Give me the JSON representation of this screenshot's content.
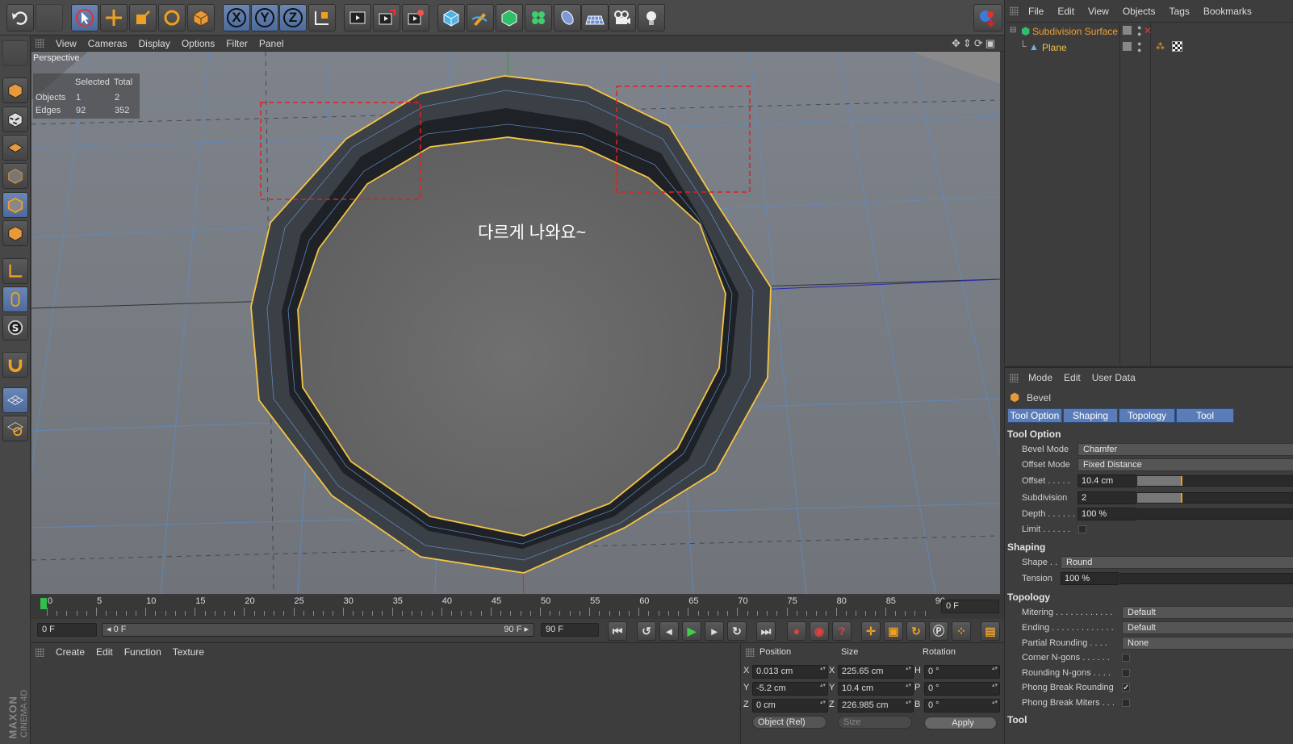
{
  "toolbar": {
    "axis_x": "X",
    "axis_y": "Y",
    "axis_z": "Z",
    "icons": [
      "undo-icon",
      "redo-icon",
      "select-icon",
      "move-icon",
      "scale-icon",
      "rotate-icon",
      "live-selection-icon",
      "world-coords-icon",
      "render-view-icon",
      "render-picture-viewer-icon",
      "render-settings-icon",
      "cube-icon",
      "pen-icon",
      "subdivision-icon",
      "cloner-icon",
      "deformer-icon",
      "floor-icon",
      "camera-icon",
      "light-icon",
      "logo-icon"
    ]
  },
  "viewport": {
    "menu": [
      "View",
      "Cameras",
      "Display",
      "Options",
      "Filter",
      "Panel"
    ],
    "camera_label": "Perspective",
    "hud": {
      "header_selected": "Selected",
      "header_total": "Total",
      "rows": [
        {
          "label": "Objects",
          "selected": "1",
          "total": "2"
        },
        {
          "label": "Edges",
          "selected": "92",
          "total": "352"
        }
      ]
    },
    "annotation": "다르게 나와요~",
    "colors": {
      "selection": "#f5c542",
      "highlight_box": "#e02020"
    }
  },
  "timeline": {
    "ticks": [
      "0",
      "5",
      "10",
      "15",
      "20",
      "25",
      "30",
      "35",
      "40",
      "45",
      "50",
      "55",
      "60",
      "65",
      "70",
      "75",
      "80",
      "85",
      "90"
    ],
    "current_frame": "0 F"
  },
  "controls": {
    "start_frame": "0 F",
    "range_start": "◂ 0 F",
    "range_end": "90 F ▸",
    "end_frame": "90 F"
  },
  "materials": {
    "menu": [
      "Create",
      "Edit",
      "Function",
      "Texture"
    ]
  },
  "coordinates": {
    "headers": {
      "position": "Position",
      "size": "Size",
      "rotation": "Rotation"
    },
    "rows": [
      {
        "axis": "X",
        "pos": "0.013 cm",
        "size_axis": "X",
        "size": "225.65 cm",
        "rot_axis": "H",
        "rot": "0 °"
      },
      {
        "axis": "Y",
        "pos": "-5.2 cm",
        "size_axis": "Y",
        "size": "10.4 cm",
        "rot_axis": "P",
        "rot": "0 °"
      },
      {
        "axis": "Z",
        "pos": "0 cm",
        "size_axis": "Z",
        "size": "226.985 cm",
        "rot_axis": "B",
        "rot": "0 °"
      }
    ],
    "mode": "Object (Rel)",
    "size_mode": "Size",
    "apply": "Apply"
  },
  "object_manager": {
    "menu": [
      "File",
      "Edit",
      "View",
      "Objects",
      "Tags",
      "Bookmarks"
    ],
    "objects": [
      {
        "name": "Subdivision Surface",
        "color": "#f0a030"
      },
      {
        "name": "Plane",
        "color": "#f0c040"
      }
    ]
  },
  "attributes": {
    "menu": [
      "Mode",
      "Edit",
      "User Data"
    ],
    "tool_name": "Bevel",
    "tabs": [
      "Tool Option",
      "Shaping",
      "Topology",
      "Tool"
    ],
    "tool_option": {
      "title": "Tool Option",
      "bevel_mode_label": "Bevel Mode",
      "bevel_mode": "Chamfer",
      "offset_mode_label": "Offset Mode",
      "offset_mode": "Fixed Distance",
      "offset_label": "Offset . . . . .",
      "offset": "10.4 cm",
      "offset_fraction": 0.28,
      "subdivision_label": "Subdivision",
      "subdivision": "2",
      "subdivision_fraction": 0.28,
      "depth_label": "Depth . . . . . .",
      "depth": "100 %",
      "depth_fraction": 0,
      "limit_label": "Limit . . . . . ."
    },
    "shaping": {
      "title": "Shaping",
      "shape_label": "Shape . .",
      "shape": "Round",
      "tension_label": "Tension",
      "tension": "100 %",
      "tension_fraction": 0
    },
    "topology": {
      "title": "Topology",
      "mitering_label": "Mitering . . . . . . . . . . . .",
      "mitering": "Default",
      "ending_label": "Ending . . . . . . . . . . . . .",
      "ending": "Default",
      "partial_rounding_label": "Partial Rounding . . . .",
      "partial_rounding": "None",
      "corner_ngons_label": "Corner N-gons . . . . . .",
      "rounding_ngons_label": "Rounding N-gons . . . .",
      "phong_break_rounding_label": "Phong Break Rounding",
      "phong_break_rounding_check": "✓",
      "phong_break_miters_label": "Phong Break Miters . . ."
    },
    "tool_section": "Tool"
  },
  "branding": {
    "maxon": "MAXON",
    "product": "CINEMA 4D"
  }
}
